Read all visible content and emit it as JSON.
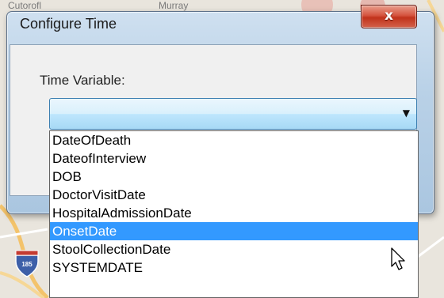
{
  "background": {
    "top_labels": [
      "Cutorofl",
      "Murray"
    ],
    "route_shield": "185"
  },
  "dialog": {
    "title": "Configure Time",
    "close_glyph": "x",
    "time_variable_label": "Time Variable:",
    "selected_value": "",
    "options": [
      {
        "label": "DateOfDeath",
        "selected": false
      },
      {
        "label": "DateofInterview",
        "selected": false
      },
      {
        "label": "DOB",
        "selected": false
      },
      {
        "label": "DoctorVisitDate",
        "selected": false
      },
      {
        "label": "HospitalAdmissionDate",
        "selected": false
      },
      {
        "label": "OnsetDate",
        "selected": true
      },
      {
        "label": "StoolCollectionDate",
        "selected": false
      },
      {
        "label": "SYSTEMDATE",
        "selected": false
      }
    ]
  },
  "colors": {
    "highlight": "#3399ff",
    "close_button": "#c8402a",
    "title_bar": "#b9d1e7"
  }
}
